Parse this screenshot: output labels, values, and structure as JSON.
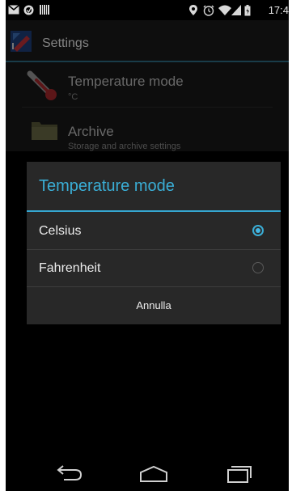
{
  "status_bar": {
    "time": "17:4",
    "icons": [
      "mail-icon",
      "sync-icon",
      "barcode-icon",
      "location-icon",
      "alarm-icon",
      "wifi-icon",
      "signal-icon",
      "battery-icon"
    ]
  },
  "action_bar": {
    "title": "Settings",
    "logo_icon": "app-logo-icon"
  },
  "preferences": [
    {
      "icon": "thermometer-icon",
      "title": "Temperature mode",
      "summary": "°C"
    },
    {
      "icon": "folder-icon",
      "title": "Archive",
      "summary": "Storage and archive settings"
    }
  ],
  "dialog": {
    "title": "Temperature mode",
    "options": [
      {
        "label": "Celsius",
        "selected": true
      },
      {
        "label": "Fahrenheit",
        "selected": false
      }
    ],
    "cancel_label": "Annulla"
  },
  "nav_bar": {
    "icons": [
      "back-icon",
      "home-icon",
      "recent-apps-icon"
    ]
  },
  "colors": {
    "accent": "#3aaed6",
    "dialog_bg": "#282828",
    "action_bar_rule": "#2f6e85"
  }
}
